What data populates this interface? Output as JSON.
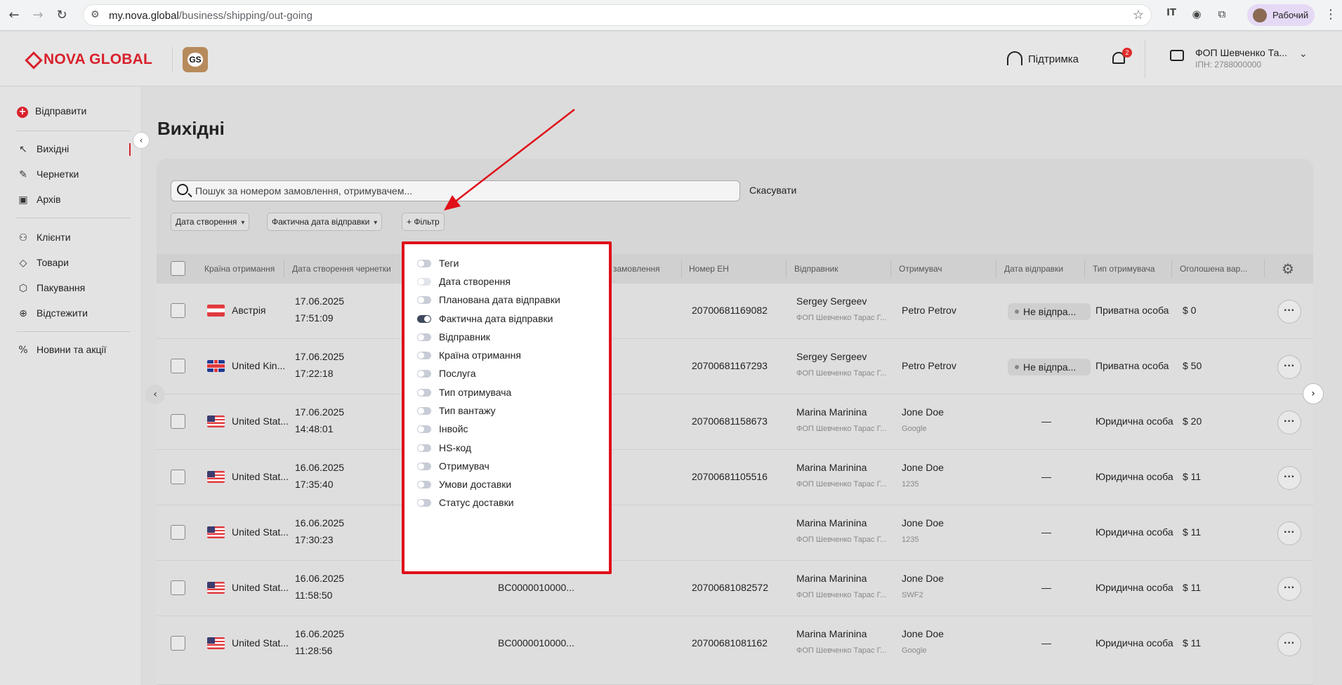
{
  "browser": {
    "url_host": "my.nova.global",
    "url_path": "/business/shipping/out-going",
    "profile_name": "Рабочий"
  },
  "header": {
    "logo_text": "NOVA GLOBAL",
    "badge_text": "GS",
    "support_label": "Підтримка",
    "notifications_count": "2",
    "company_name": "ФОП Шевченко Та...",
    "company_inn": "ІПН: 2788000000"
  },
  "sidebar": {
    "send_label": "Відправити",
    "items": [
      {
        "label": "Вихідні"
      },
      {
        "label": "Чернетки"
      },
      {
        "label": "Архів"
      },
      {
        "label": "Клієнти"
      },
      {
        "label": "Товари"
      },
      {
        "label": "Пакування"
      },
      {
        "label": "Відстежити"
      },
      {
        "label": "Новини та акції"
      }
    ]
  },
  "main": {
    "title": "Вихідні",
    "search_placeholder": "Пошук за номером замовлення, отримувачем...",
    "cancel_label": "Скасувати",
    "filters": [
      "Дата створення",
      "Фактична дата відправки"
    ],
    "add_filter_label": "+ Фільтр"
  },
  "table": {
    "columns": [
      "Країна отримання",
      "Дата створення чернетки",
      "замовлення",
      "Номер ЕН",
      "Відправник",
      "Отримувач",
      "Дата відправки",
      "Тип отримувача",
      "Оголошена вар..."
    ],
    "rows": [
      {
        "country": "Австрія",
        "date": "17.06.2025",
        "time": "17:51:09",
        "order": "",
        "en": "20700681169082",
        "sender": "Sergey Sergeev",
        "sender_sub": "ФОП Шевченко Тарас Г...",
        "recipient": "Petro Petrov",
        "recipient_sub": "",
        "ship_status": "Не відпра...",
        "rtype": "Приватна особа",
        "value": "$ 0"
      },
      {
        "country": "United Kin...",
        "date": "17.06.2025",
        "time": "17:22:18",
        "order": "",
        "en": "20700681167293",
        "sender": "Sergey Sergeev",
        "sender_sub": "ФОП Шевченко Тарас Г...",
        "recipient": "Petro Petrov",
        "recipient_sub": "",
        "ship_status": "Не відпра...",
        "rtype": "Приватна особа",
        "value": "$ 50"
      },
      {
        "country": "United Stat...",
        "date": "17.06.2025",
        "time": "14:48:01",
        "order": "",
        "en": "20700681158673",
        "sender": "Marina Marinina",
        "sender_sub": "ФОП Шевченко Тарас Г...",
        "recipient": "Jone Doe",
        "recipient_sub": "Google",
        "ship_status": "—",
        "rtype": "Юридична особа",
        "value": "$ 20"
      },
      {
        "country": "United Stat...",
        "date": "16.06.2025",
        "time": "17:35:40",
        "order": "",
        "en": "20700681105516",
        "sender": "Marina Marinina",
        "sender_sub": "ФОП Шевченко Тарас Г...",
        "recipient": "Jone Doe",
        "recipient_sub": "1235",
        "ship_status": "—",
        "rtype": "Юридична особа",
        "value": "$ 11"
      },
      {
        "country": "United Stat...",
        "date": "16.06.2025",
        "time": "17:30:23",
        "order": "",
        "en": "",
        "sender": "Marina Marinina",
        "sender_sub": "ФОП Шевченко Тарас Г...",
        "recipient": "Jone Doe",
        "recipient_sub": "1235",
        "ship_status": "—",
        "rtype": "Юридична особа",
        "value": "$ 11"
      },
      {
        "country": "United Stat...",
        "date": "16.06.2025",
        "time": "11:58:50",
        "order": "BC0000010000...",
        "en": "20700681082572",
        "sender": "Marina Marinina",
        "sender_sub": "ФОП Шевченко Тарас Г...",
        "recipient": "Jone Doe",
        "recipient_sub": "SWF2",
        "ship_status": "—",
        "rtype": "Юридична особа",
        "value": "$ 11"
      },
      {
        "country": "United Stat...",
        "date": "16.06.2025",
        "time": "11:28:56",
        "order": "BC0000010000...",
        "en": "20700681081162",
        "sender": "Marina Marinina",
        "sender_sub": "ФОП Шевченко Тарас Г...",
        "recipient": "Jone Doe",
        "recipient_sub": "Google",
        "ship_status": "—",
        "rtype": "Юридична особа",
        "value": "$ 11"
      }
    ]
  },
  "column_picker": {
    "options": [
      {
        "label": "Теги",
        "state": "off"
      },
      {
        "label": "Дата створення",
        "state": "disabled"
      },
      {
        "label": "Планована дата відправки",
        "state": "off"
      },
      {
        "label": "Фактична дата відправки",
        "state": "on"
      },
      {
        "label": "Відправник",
        "state": "off"
      },
      {
        "label": "Країна отримання",
        "state": "off"
      },
      {
        "label": "Послуга",
        "state": "off"
      },
      {
        "label": "Тип отримувача",
        "state": "off"
      },
      {
        "label": "Тип вантажу",
        "state": "off"
      },
      {
        "label": "Інвойс",
        "state": "off"
      },
      {
        "label": "HS-код",
        "state": "off"
      },
      {
        "label": "Отримувач",
        "state": "off"
      },
      {
        "label": "Умови доставки",
        "state": "off"
      },
      {
        "label": "Статус доставки",
        "state": "off"
      }
    ]
  },
  "colors": {
    "brand_red": "#d8212c",
    "annotation_red": "#e0101a",
    "toggle_on": "#3e4a5c"
  }
}
